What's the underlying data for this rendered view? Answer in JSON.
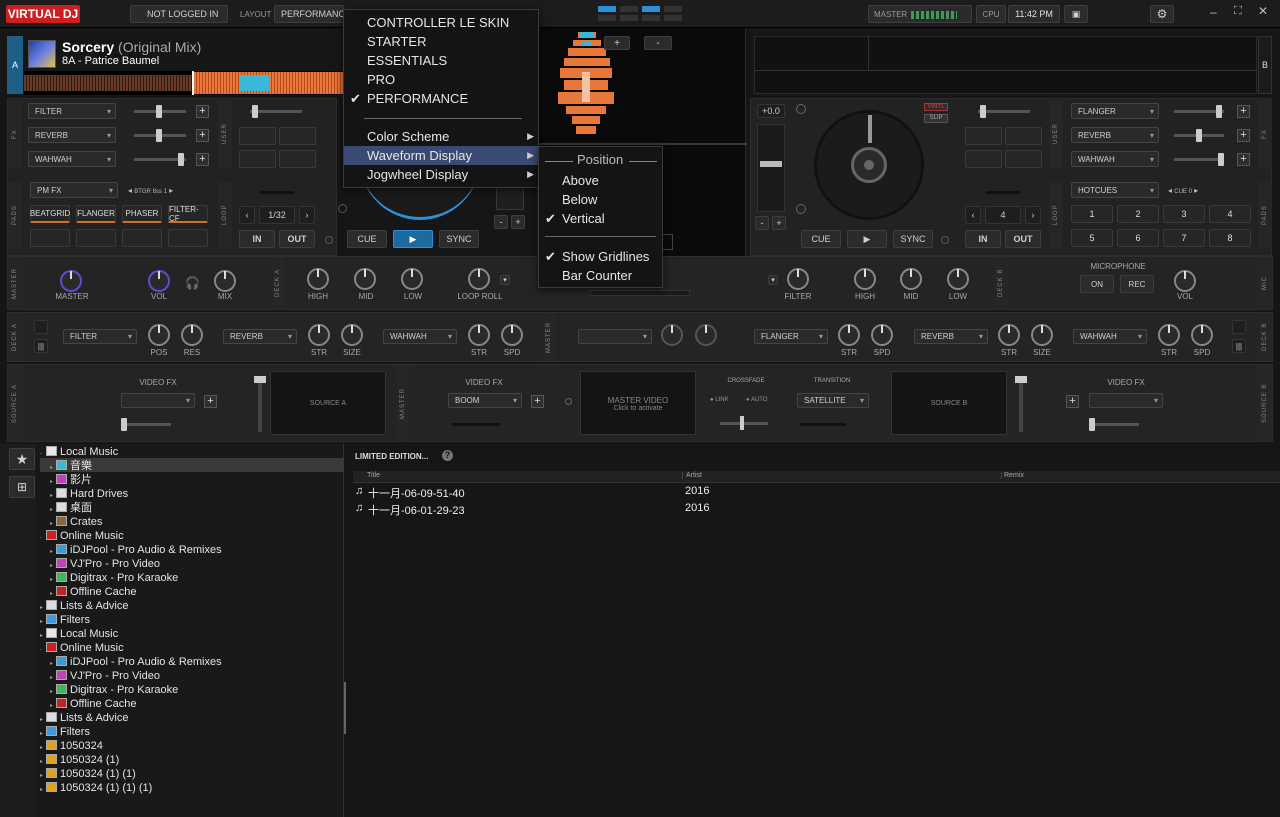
{
  "app": {
    "logo": "VIRTUAL DJ",
    "login": "NOT LOGGED IN",
    "layout_label": "LAYOUT",
    "layout_value": "PERFORMANCE",
    "master_label": "MASTER",
    "cpu_label": "CPU",
    "clock": "11:42 PM"
  },
  "deckA": {
    "letter": "A",
    "title": "Sorcery",
    "mix": "(Original Mix)",
    "key_artist": "8A - Patrice Baumel",
    "fx": [
      "FILTER",
      "REVERB",
      "WAHWAH"
    ],
    "pad_mode": "PM FX",
    "beat": "BTGR 8ss 1",
    "pads": [
      "BEATGRID",
      "FLANGER",
      "PHASER",
      "FILTER-CF"
    ],
    "loop": "1/32",
    "in": "IN",
    "out": "OUT",
    "cue": "CUE",
    "sync": "SYNC"
  },
  "deckB": {
    "letter": "B",
    "pitch": "+0.0",
    "vinyl": "VINYL",
    "slip": "SLIP",
    "fx": [
      "FLANGER",
      "REVERB",
      "WAHWAH"
    ],
    "pad_mode": "HOTCUES",
    "cue_label": "CUE 0",
    "pads": [
      "1",
      "2",
      "3",
      "4",
      "5",
      "6",
      "7",
      "8"
    ],
    "loop": "4",
    "in": "IN",
    "out": "OUT",
    "cue": "CUE",
    "sync": "SYNC"
  },
  "side_labels": {
    "fx": "FX",
    "user": "USER",
    "pads": "PADS",
    "loop": "LOOP",
    "master": "MASTER",
    "deck_a": "DECK A",
    "deck_b": "DECK B",
    "source_a": "SOURCE A",
    "source_b": "SOURCE B",
    "mic": "MIC"
  },
  "mixer": {
    "master": "MASTER",
    "vol": "VOL",
    "mix": "MIX",
    "high": "HIGH",
    "mid": "MID",
    "low": "LOW",
    "loop_roll": "LOOP ROLL",
    "filter": "FILTER",
    "microphone": "MICROPHONE",
    "on": "ON",
    "rec": "REC",
    "mic_vol": "VOL"
  },
  "fxrow": {
    "a1": "FILTER",
    "a1k": [
      "POS",
      "RES"
    ],
    "a2": "REVERB",
    "a2k": [
      "STR",
      "SIZE"
    ],
    "a3": "WAHWAH",
    "a3k": [
      "STR",
      "SPD"
    ],
    "b1": "FLANGER",
    "b1k": [
      "STR",
      "SPD"
    ],
    "b2": "REVERB",
    "b2k": [
      "STR",
      "SIZE"
    ],
    "b3": "WAHWAH",
    "b3k": [
      "STR",
      "SPD"
    ]
  },
  "video": {
    "video_fx": "VIDEO FX",
    "boom": "BOOM",
    "source_a": "SOURCE A",
    "source_b": "SOURCE B",
    "master_video": "MASTER VIDEO",
    "click": "Click to activate",
    "crossfade": "CROSSFADE",
    "transition": "TRANSITION",
    "link": "LINK",
    "auto": "AUTO",
    "satellite": "SATELLITE"
  },
  "menu": {
    "items": [
      "CONTROLLER LE SKIN",
      "STARTER",
      "ESSENTIALS",
      "PRO",
      "PERFORMANCE",
      "Color Scheme",
      "Waveform Display",
      "Jogwheel Display"
    ],
    "checked": "PERFORMANCE",
    "selected": "Waveform Display"
  },
  "submenu": {
    "header": "Position",
    "items": [
      "Above",
      "Below",
      "Vertical",
      "Show Gridlines",
      "Bar Counter"
    ],
    "checked": [
      "Vertical",
      "Show Gridlines"
    ]
  },
  "browser": {
    "folder_title": "LIMITED EDITION...",
    "columns": [
      "Title",
      "Artist",
      "Remix"
    ],
    "rows": [
      {
        "title": "十一月-06-09-51-40",
        "artist": "2016"
      },
      {
        "title": "十一月-06-01-29-23",
        "artist": "2016"
      }
    ],
    "folders_tab": "folders",
    "tree": [
      "Local Music",
      "音樂",
      "影片",
      "Hard Drives",
      "桌面",
      "Crates",
      "Online Music",
      "iDJPool - Pro Audio & Remixes",
      "VJ'Pro - Pro Video",
      "Digitrax - Pro Karaoke",
      "Offline Cache",
      "Lists & Advice",
      "Filters",
      "Local Music",
      "Online Music",
      "iDJPool - Pro Audio & Remixes",
      "VJ'Pro - Pro Video",
      "Digitrax - Pro Karaoke",
      "Offline Cache",
      "Lists & Advice",
      "Filters",
      "1050324",
      "1050324 (1)",
      "1050324 (1) (1)",
      "1050324 (1) (1) (1)"
    ]
  },
  "colors": {
    "accent": "#2d8fd6",
    "menu_highlight": "#3b4a72",
    "logo_red": "#cc1f1f",
    "wave_orange": "#e8773a",
    "wave_cyan": "#3ab8d8",
    "knob_blue": "#5b4fd6"
  }
}
